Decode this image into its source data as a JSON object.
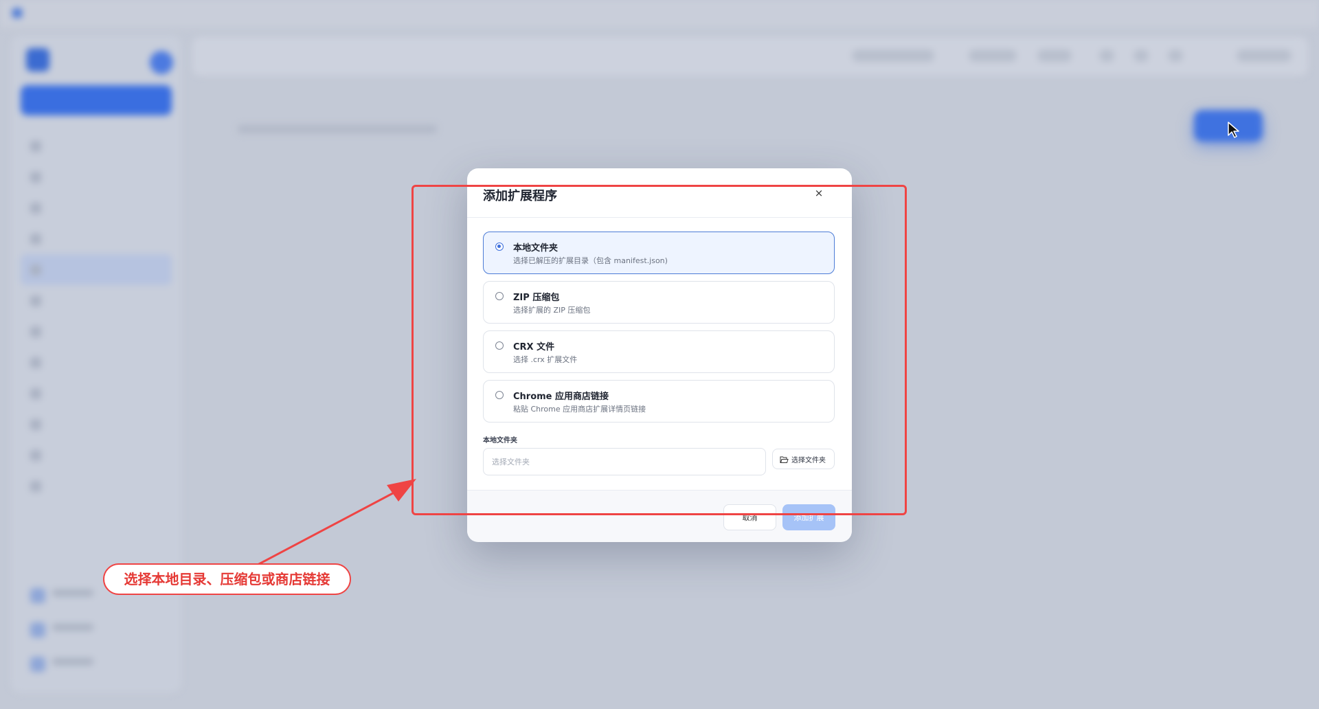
{
  "background": {
    "window_title": "",
    "logo_name": "",
    "new_button_label": "",
    "nav_items": [
      "",
      "",
      "",
      "",
      "",
      "",
      "",
      "",
      "",
      "",
      "",
      ""
    ],
    "active_nav_index": 4,
    "page_title": "",
    "brand_color": "#3a6ee0"
  },
  "modal": {
    "title": "添加扩展程序",
    "close_label": "×",
    "selected_option": "local_folder",
    "options": [
      {
        "key": "local_folder",
        "title": "本地文件夹",
        "description": "选择已解压的扩展目录（包含 manifest.json)"
      },
      {
        "key": "zip",
        "title": "ZIP 压缩包",
        "description": "选择扩展的 ZIP 压缩包"
      },
      {
        "key": "crx",
        "title": "CRX 文件",
        "description": "选择 .crx 扩展文件"
      },
      {
        "key": "store_link",
        "title": "Chrome 应用商店链接",
        "description": "粘贴 Chrome 应用商店扩展详情页链接"
      }
    ],
    "field_label": "本地文件夹",
    "input_value": "",
    "input_placeholder": "选择文件夹",
    "browse_icon": "folder-open-icon",
    "browse_label": "选择文件夹",
    "cancel_label": "取消",
    "confirm_label": "添加扩展",
    "confirm_enabled": false,
    "accent_color": "#3d6fdc"
  },
  "annotation": {
    "callout_text": "选择本地目录、压缩包或商店链接",
    "color": "#ef4444"
  }
}
